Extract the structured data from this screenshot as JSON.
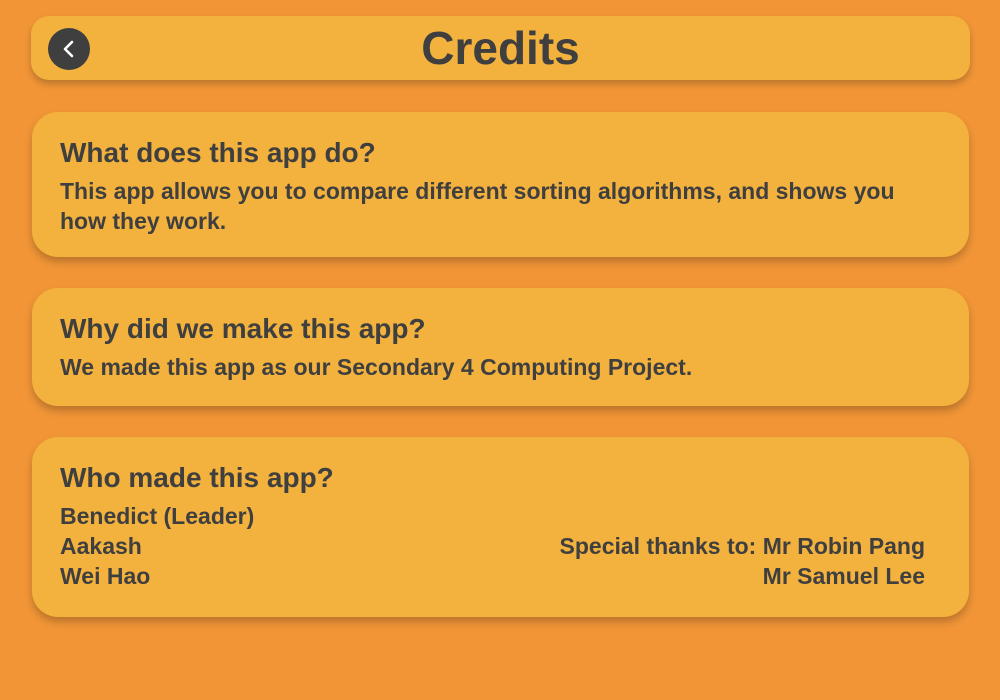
{
  "header": {
    "title": "Credits",
    "back_icon": "chevron-left-icon"
  },
  "colors": {
    "background": "#F19537",
    "card": "#F3B23D",
    "text": "#3f3f3f",
    "back_button": "#3f3f3f"
  },
  "sections": {
    "about": {
      "heading": "What does this app do?",
      "body": "This app allows you to compare different sorting algorithms, and shows you how they work."
    },
    "why": {
      "heading": "Why did we make this app?",
      "body": "We made this app as our Secondary 4 Computing Project."
    },
    "who": {
      "heading": "Who made this app?",
      "makers": [
        "Benedict (Leader)",
        "Aakash",
        "Wei Hao"
      ],
      "thanks_label_line": "Special thanks to: Mr Robin Pang",
      "thanks_second_line": "Mr Samuel Lee"
    }
  }
}
